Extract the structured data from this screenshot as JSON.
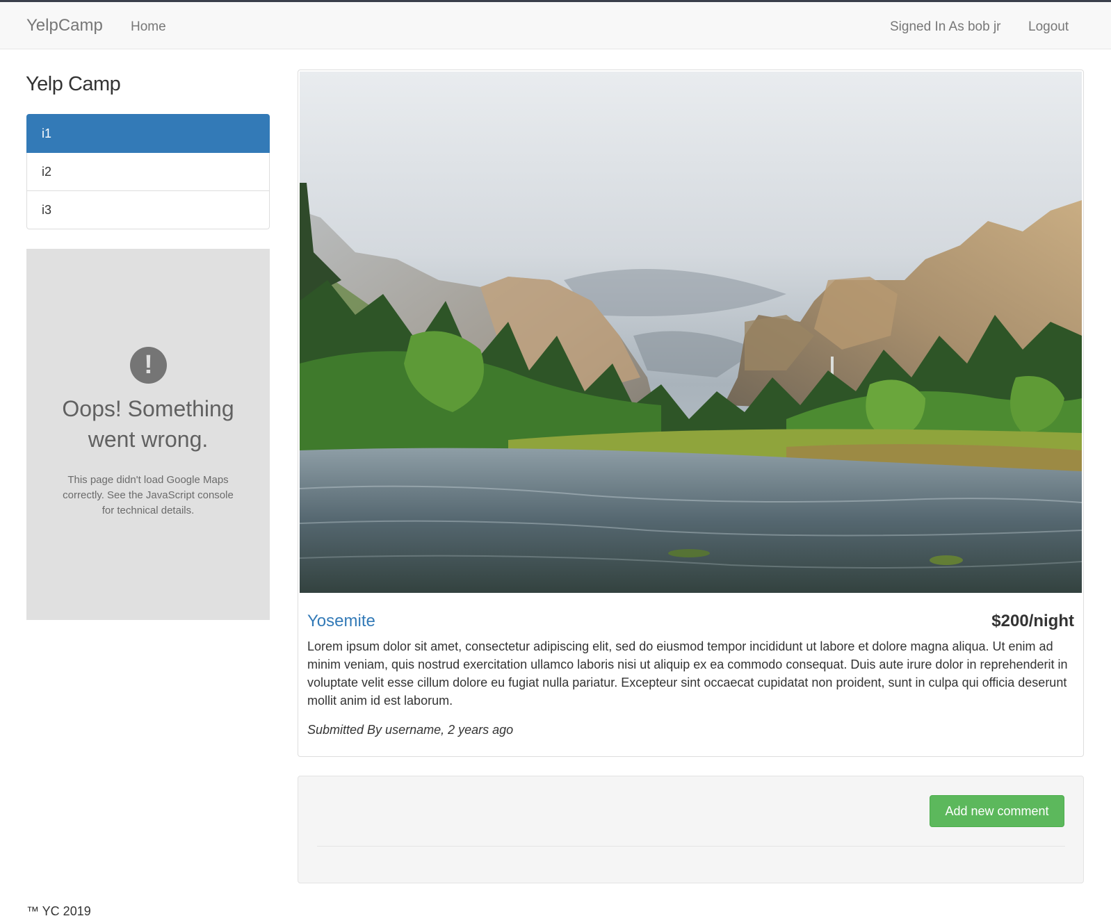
{
  "navbar": {
    "brand": "YelpCamp",
    "home": "Home",
    "signed_in": "Signed In As bob jr",
    "logout": "Logout"
  },
  "sidebar": {
    "heading": "Yelp Camp",
    "items": [
      {
        "label": "i1",
        "active": true
      },
      {
        "label": "i2",
        "active": false
      },
      {
        "label": "i3",
        "active": false
      }
    ]
  },
  "map": {
    "icon": "exclamation-icon",
    "title": "Oops! Something went wrong.",
    "detail": "This page didn't load Google Maps correctly. See the JavaScript console for technical details."
  },
  "campground": {
    "name": "Yosemite",
    "price": "$200/night",
    "description": "Lorem ipsum dolor sit amet, consectetur adipiscing elit, sed do eiusmod tempor incididunt ut labore et dolore magna aliqua. Ut enim ad minim veniam, quis nostrud exercitation ullamco laboris nisi ut aliquip ex ea commodo consequat. Duis aute irure dolor in reprehenderit in voluptate velit esse cillum dolore eu fugiat nulla pariatur. Excepteur sint occaecat cupidatat non proident, sunt in culpa qui officia deserunt mollit anim id est laborum.",
    "submitted": "Submitted By username, 2 years ago"
  },
  "comments": {
    "add_button": "Add new comment"
  },
  "footer": {
    "text": "™ YC 2019"
  },
  "colors": {
    "active": "#337ab7",
    "success": "#5cb85c",
    "link": "#337ab7"
  }
}
